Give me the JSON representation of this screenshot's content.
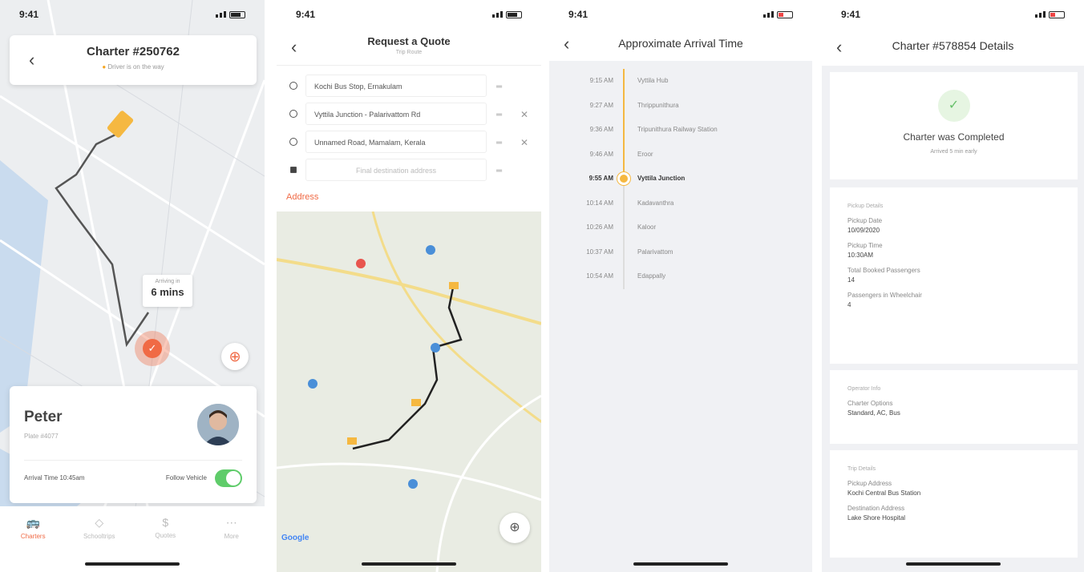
{
  "screen1": {
    "status": {
      "time": "9:41"
    },
    "header": {
      "title": "Charter #250762",
      "subtitle": "Driver is on the way"
    },
    "eta": {
      "label": "Arriving in",
      "value": "6 mins"
    },
    "driver": {
      "name": "Peter",
      "plate": "Plate #4077",
      "arrival_label": "Arrival Time 10:45am",
      "follow_label": "Follow Vehicle",
      "follow_on": true
    },
    "tabs": [
      {
        "icon": "🚌",
        "label": "Charters",
        "active": true
      },
      {
        "icon": "◇",
        "label": "Schooltrips",
        "active": false
      },
      {
        "icon": "$",
        "label": "Quotes",
        "active": false
      },
      {
        "icon": "⋯",
        "label": "More",
        "active": false
      }
    ]
  },
  "screen2": {
    "status": {
      "time": "9:41"
    },
    "header": {
      "title": "Request a Quote",
      "subtitle": "Trip Route"
    },
    "stops": [
      {
        "text": "Kochi Bus Stop, Ernakulam",
        "removable": false,
        "type": "origin"
      },
      {
        "text": "Vyttila Junction - Palarivattom Rd",
        "removable": true,
        "type": "stop"
      },
      {
        "text": "Unnamed Road, Mamalam, Kerala",
        "removable": true,
        "type": "stop"
      },
      {
        "text": "Final destination address",
        "removable": false,
        "type": "destination"
      }
    ],
    "address_label": "Address",
    "map_brand": "Google"
  },
  "screen3": {
    "status": {
      "time": "9:41"
    },
    "header": {
      "title": "Approximate Arrival Time"
    },
    "timeline": [
      {
        "time": "9:15 AM",
        "name": "Vyttila Hub",
        "current": false
      },
      {
        "time": "9:27 AM",
        "name": "Thrippunithura",
        "current": false
      },
      {
        "time": "9:36 AM",
        "name": "Tripunithura Railway Station",
        "current": false
      },
      {
        "time": "9:46 AM",
        "name": "Eroor",
        "current": false
      },
      {
        "time": "9:55 AM",
        "name": "Vyttila Junction",
        "current": true
      },
      {
        "time": "10:14 AM",
        "name": "Kadavanthra",
        "current": false
      },
      {
        "time": "10:26 AM",
        "name": "Kaloor",
        "current": false
      },
      {
        "time": "10:37 AM",
        "name": "Palarivattom",
        "current": false
      },
      {
        "time": "10:54 AM",
        "name": "Edappally",
        "current": false
      }
    ],
    "progress_fraction": 0.5
  },
  "screen4": {
    "status": {
      "time": "9:41"
    },
    "header": {
      "title": "Charter #578854 Details"
    },
    "completed": {
      "title": "Charter was Completed",
      "subtitle": "Arrived 5 min early"
    },
    "pickup": {
      "heading": "Pickup Details",
      "fields": [
        {
          "label": "Pickup Date",
          "value": "10/09/2020"
        },
        {
          "label": "Pickup Time",
          "value": "10:30AM"
        },
        {
          "label": "Total Booked Passengers",
          "value": "14"
        },
        {
          "label": "Passengers in Wheelchair",
          "value": "4"
        }
      ]
    },
    "operator": {
      "heading": "Operator Info",
      "fields": [
        {
          "label": "Charter Options",
          "value": "Standard, AC, Bus"
        }
      ]
    },
    "trip": {
      "heading": "Trip Details",
      "fields": [
        {
          "label": "Pickup Address",
          "value": "Kochi Central Bus Station"
        },
        {
          "label": "Destination Address",
          "value": "Lake Shore Hospital"
        }
      ]
    }
  }
}
